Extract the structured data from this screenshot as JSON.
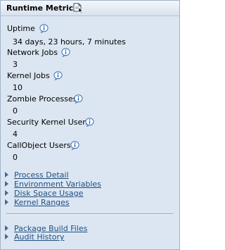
{
  "panel": {
    "title": "Runtime Metrics",
    "title_icon": "document-cursor-icon"
  },
  "metrics": [
    {
      "label": "Uptime",
      "value": "34 days, 23 hours, 7 minutes"
    },
    {
      "label": "Network Jobs",
      "value": "3"
    },
    {
      "label": "Kernel Jobs",
      "value": "10"
    },
    {
      "label": "Zombie Processes",
      "value": "0"
    },
    {
      "label": "Security Kernel Users",
      "value": "4"
    },
    {
      "label": "CallObject Users",
      "value": "0"
    }
  ],
  "links_primary": [
    {
      "label": "Process Detail"
    },
    {
      "label": "Environment Variables"
    },
    {
      "label": "Disk Space Usage"
    },
    {
      "label": "Kernel Ranges"
    }
  ],
  "links_secondary": [
    {
      "label": "Package Build Files"
    },
    {
      "label": "Audit History"
    }
  ],
  "colors": {
    "panel_bg": "#dce6f2",
    "link": "#1f4f82",
    "arrow": "#3e6d9c",
    "info_icon": "#3a72b8"
  }
}
